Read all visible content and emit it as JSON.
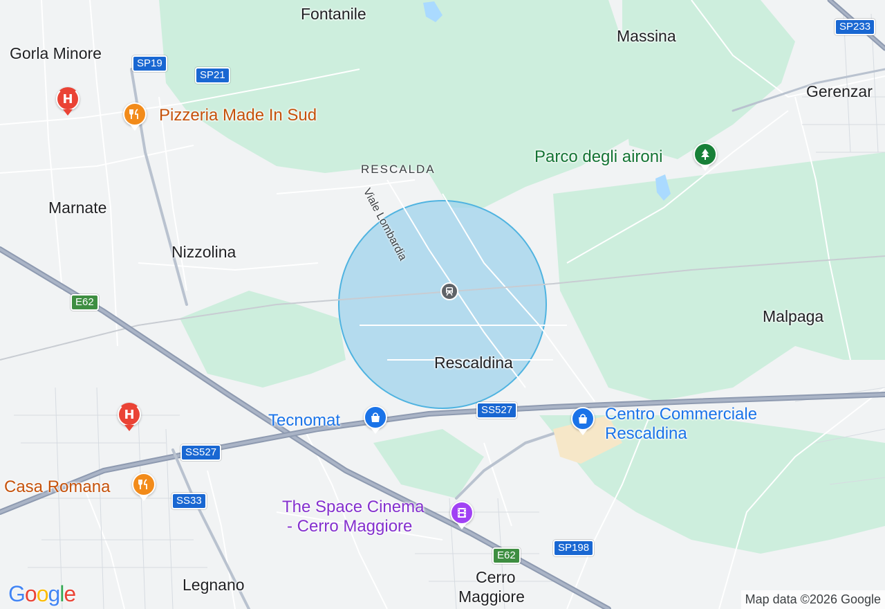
{
  "map": {
    "places": {
      "fontanile": "Fontanile",
      "massina": "Massina",
      "gorla_minore": "Gorla Minore",
      "gerenzano": "Gerenzar",
      "marnate": "Marnate",
      "nizzolina": "Nizzolina",
      "rescalda": "RESCALDA",
      "malpaga": "Malpaga",
      "rescaldina": "Rescaldina",
      "legnano": "Legnano",
      "cerro_maggiore_line1": "Cerro",
      "cerro_maggiore_line2": "Maggiore"
    },
    "streets": {
      "viale_lombardia": "Viale Lombardia"
    },
    "road_shields": {
      "sp19": "SP19",
      "sp21": "SP21",
      "sp233": "SP233",
      "e62_west": "E62",
      "e62_south": "E62",
      "ss527_center": "SS527",
      "ss527_west": "SS527",
      "ss33": "SS33",
      "sp198": "SP198"
    },
    "pois": {
      "pizzeria": "Pizzeria Made In Sud",
      "parco": "Parco degli aironi",
      "tecnomat": "Tecnomat",
      "centro_line1": "Centro Commerciale",
      "centro_line2": "Rescaldina",
      "casa_romana": "Casa Romana",
      "cinema_line1": "The Space Cinema",
      "cinema_line2": "- Cerro Maggiore"
    },
    "icons": {
      "hospital": "hospital-icon",
      "restaurant": "restaurant-icon",
      "park": "tree-icon",
      "shopping": "shopping-bag-icon",
      "cinema": "film-icon",
      "train": "train-station-icon"
    },
    "colors": {
      "green_area": "#cdeedd",
      "search_radius_fill": "#9fd3ec",
      "search_radius_stroke": "#4fb3e0",
      "highway": "#8e9ab0",
      "shield_sp": "#1967d2",
      "shield_e": "#3e8e41"
    }
  },
  "branding": {
    "logo": "Google",
    "attribution": "Map data ©2026 Google"
  }
}
